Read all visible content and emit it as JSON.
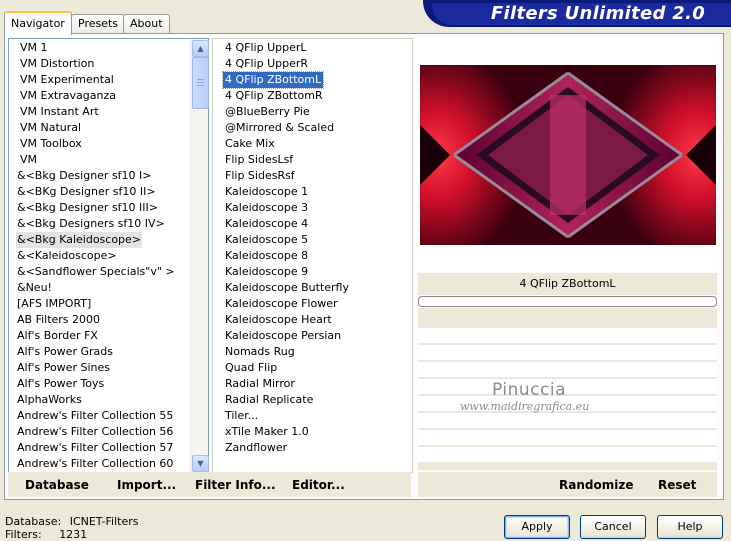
{
  "app": {
    "title": "Filters Unlimited 2.0"
  },
  "tabs": [
    {
      "label": "Navigator",
      "active": true
    },
    {
      "label": "Presets",
      "active": false
    },
    {
      "label": "About",
      "active": false
    }
  ],
  "categories": {
    "selected_index": 12,
    "items": [
      "VM 1",
      "VM Distortion",
      "VM Experimental",
      "VM Extravaganza",
      "VM Instant Art",
      "VM Natural",
      "VM Toolbox",
      "VM",
      "&<Bkg Designer sf10 I>",
      "&<BKg Designer sf10 II>",
      "&<Bkg Designer sf10 III>",
      "&<Bkg Designers sf10 IV>",
      "&<Bkg Kaleidoscope>",
      "&<Kaleidoscope>",
      "&<Sandflower Specials\"v\" >",
      "&Neu!",
      "[AFS IMPORT]",
      "AB Filters 2000",
      "Alf's Border FX",
      "Alf's Power Grads",
      "Alf's Power Sines",
      "Alf's Power Toys",
      "AlphaWorks",
      "Andrew's Filter Collection 55",
      "Andrew's Filter Collection 56",
      "Andrew's Filter Collection 57",
      "Andrew's Filter Collection 60"
    ]
  },
  "filters": {
    "selected_index": 2,
    "items": [
      "4 QFlip UpperL",
      "4 QFlip UpperR",
      "4 QFlip ZBottomL",
      "4 QFlip ZBottomR",
      "@BlueBerry Pie",
      "@Mirrored & Scaled",
      "Cake Mix",
      "Flip SidesLsf",
      "Flip SidesRsf",
      "Kaleidoscope 1",
      "Kaleidoscope 3",
      "Kaleidoscope 4",
      "Kaleidoscope 5",
      "Kaleidoscope 8",
      "Kaleidoscope 9",
      "Kaleidoscope Butterfly",
      "Kaleidoscope Flower",
      "Kaleidoscope Heart",
      "Kaleidoscope Persian",
      "Nomads Rug",
      "Quad Flip",
      "Radial Mirror",
      "Radial Replicate",
      "Tiler...",
      "xTile Maker 1.0",
      "Zandflower"
    ]
  },
  "preview": {
    "filter_name": "4 QFlip ZBottomL"
  },
  "watermark": {
    "name": "Pinuccia",
    "url": "www.maidiregrafica.eu"
  },
  "toolbar": {
    "database": "Database",
    "import": "Import...",
    "filter_info": "Filter Info...",
    "editor": "Editor...",
    "randomize": "Randomize",
    "reset": "Reset"
  },
  "status": {
    "database_label": "Database:",
    "database_value": "ICNET-Filters",
    "filters_label": "Filters:",
    "filters_value": "1231"
  },
  "buttons": {
    "apply": "Apply",
    "cancel": "Cancel",
    "help": "Help"
  },
  "colors": {
    "banner": "#1c2aa0",
    "selection": "#316ac5",
    "accent_tab": "#ffc83c"
  }
}
